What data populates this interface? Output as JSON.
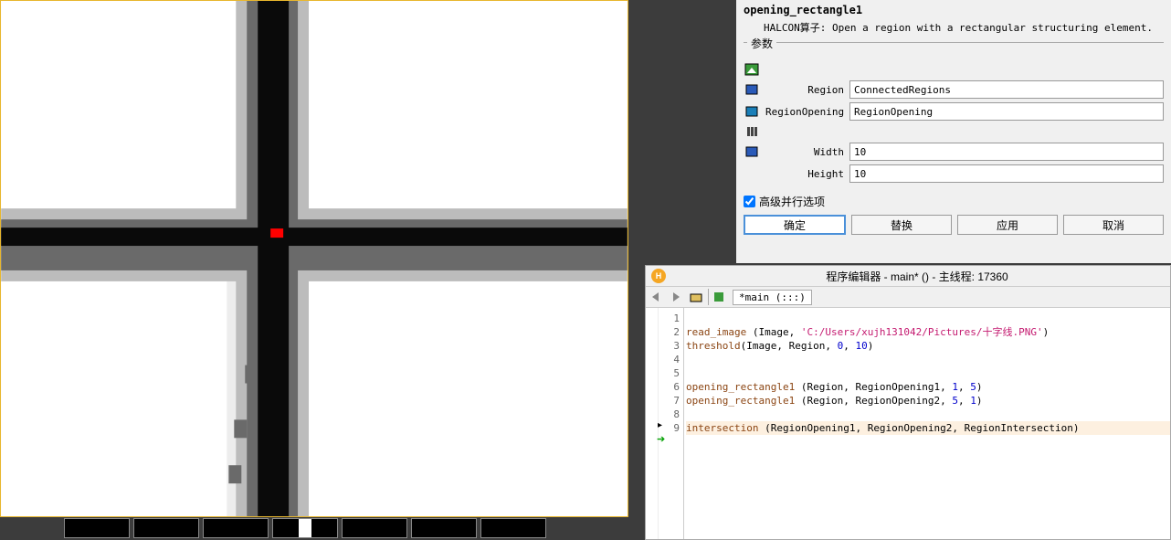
{
  "operator": {
    "name": "opening_rectangle1",
    "desc_prefix": "HALCON算子:",
    "desc": "Open a region with a rectangular structuring element."
  },
  "params": {
    "section_label": "参数",
    "region_label": "Region",
    "region_value": "ConnectedRegions",
    "regionopening_label": "RegionOpening",
    "regionopening_value": "RegionOpening",
    "width_label": "Width",
    "width_value": "10",
    "height_label": "Height",
    "height_value": "10"
  },
  "advanced": {
    "label": "高级并行选项",
    "checked": true
  },
  "buttons": {
    "ok": "确定",
    "replace": "替换",
    "apply": "应用",
    "cancel": "取消"
  },
  "editor": {
    "title": "程序编辑器 - main* () - 主线程: 17360",
    "tab": "*main (:::)"
  },
  "code": {
    "lines": [
      {
        "n": "1",
        "t": ""
      },
      {
        "n": "2",
        "t": "read_image (Image, 'C:/Users/xujh131042/Pictures/十字线.PNG')"
      },
      {
        "n": "3",
        "t": "threshold(Image, Region, 0, 10)"
      },
      {
        "n": "4",
        "t": ""
      },
      {
        "n": "5",
        "t": ""
      },
      {
        "n": "6",
        "t": "opening_rectangle1 (Region, RegionOpening1, 1, 5)"
      },
      {
        "n": "7",
        "t": "opening_rectangle1 (Region, RegionOpening2, 5, 1)"
      },
      {
        "n": "8",
        "t": ""
      },
      {
        "n": "9",
        "t": "intersection (RegionOpening1, RegionOpening2, RegionIntersection)"
      }
    ]
  }
}
